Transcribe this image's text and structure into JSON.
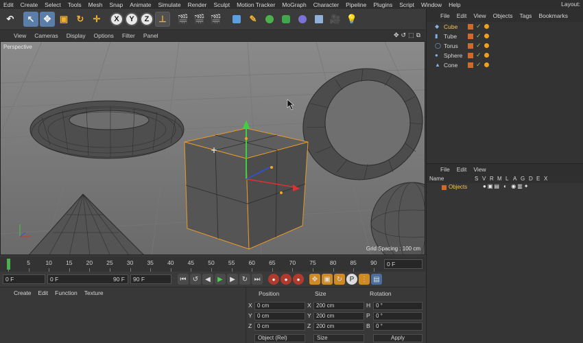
{
  "menu": [
    "Edit",
    "Create",
    "Select",
    "Tools",
    "Mesh",
    "Snap",
    "Animate",
    "Simulate",
    "Render",
    "Sculpt",
    "Motion Tracker",
    "MoGraph",
    "Character",
    "Pipeline",
    "Plugins",
    "Script",
    "Window",
    "Help"
  ],
  "layout_label": "Layout:",
  "toolbar": {
    "axis_x": "X",
    "axis_y": "Y",
    "axis_z": "Z"
  },
  "viewport_menu": [
    "View",
    "Cameras",
    "Display",
    "Options",
    "Filter",
    "Panel"
  ],
  "viewport": {
    "label": "Perspective",
    "grid_spacing": "Grid Spacing : 100 cm"
  },
  "timeline": {
    "ticks": [
      "0",
      "5",
      "10",
      "15",
      "20",
      "25",
      "30",
      "35",
      "40",
      "45",
      "50",
      "55",
      "60",
      "65",
      "70",
      "75",
      "80",
      "85",
      "90"
    ],
    "current_frame": "0 F"
  },
  "transport": {
    "start": "0 F",
    "range_start": "0 F",
    "range_end": "90 F",
    "end": "90 F"
  },
  "material_menu": [
    "Create",
    "Edit",
    "Function",
    "Texture"
  ],
  "coords": {
    "headers": [
      "Position",
      "Size",
      "Rotation"
    ],
    "rows": [
      {
        "axis": "X",
        "pos": "0 cm",
        "size_axis": "X",
        "size": "200 cm",
        "rot_axis": "H",
        "rot": "0 °"
      },
      {
        "axis": "Y",
        "pos": "0 cm",
        "size_axis": "Y",
        "size": "200 cm",
        "rot_axis": "P",
        "rot": "0 °"
      },
      {
        "axis": "Z",
        "pos": "0 cm",
        "size_axis": "Z",
        "size": "200 cm",
        "rot_axis": "B",
        "rot": "0 °"
      }
    ],
    "mode": "Object (Rel)",
    "size_mode": "Size",
    "apply": "Apply"
  },
  "object_manager": {
    "tabs": [
      "File",
      "Edit",
      "View",
      "Objects",
      "Tags",
      "Bookmarks"
    ],
    "objects": [
      {
        "name": "Cube",
        "selected": true
      },
      {
        "name": "Tube",
        "selected": false
      },
      {
        "name": "Torus",
        "selected": false
      },
      {
        "name": "Sphere",
        "selected": false
      },
      {
        "name": "Cone",
        "selected": false
      }
    ]
  },
  "layer_manager": {
    "tabs": [
      "File",
      "Edit",
      "View"
    ],
    "columns": [
      "Name",
      "S",
      "V",
      "R",
      "M",
      "L",
      "A",
      "G",
      "D",
      "E",
      "X"
    ],
    "layer": "Objects"
  }
}
